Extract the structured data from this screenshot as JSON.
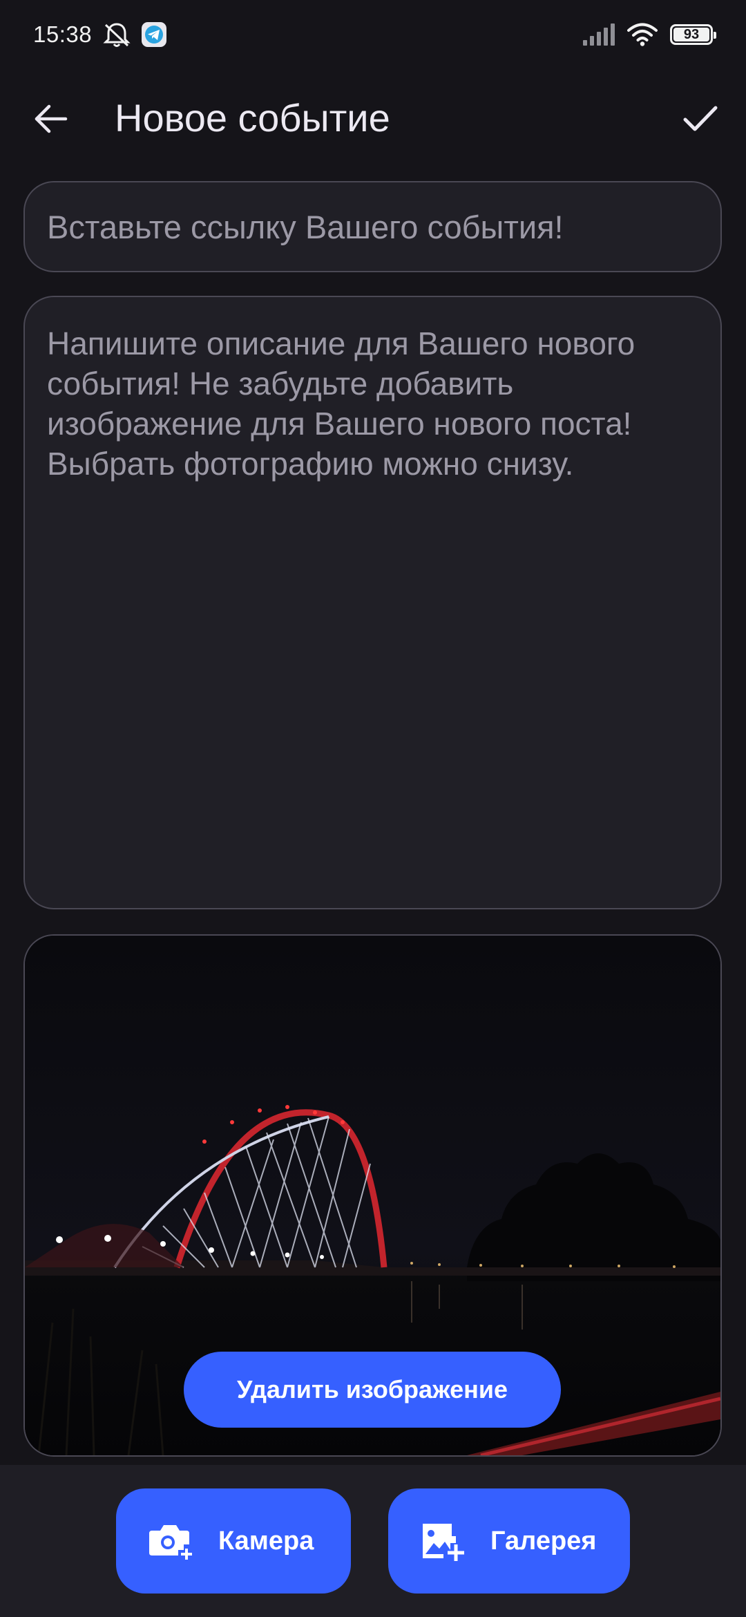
{
  "status_bar": {
    "time": "15:38",
    "battery": "93",
    "icons": [
      "notifications-off-icon",
      "telegram-icon",
      "signal-icon",
      "wifi-icon",
      "battery-icon"
    ]
  },
  "app_bar": {
    "title": "Новое событие",
    "back_icon": "arrow-left-icon",
    "confirm_icon": "checkmark-icon"
  },
  "link_field": {
    "placeholder": "Вставьте ссылку Вашего события!",
    "value": ""
  },
  "description_field": {
    "placeholder": "Напишите описание для Вашего нового события! Не забудьте добавить изображение для Вашего нового поста! Выбрать фотографию можно снизу.",
    "value": ""
  },
  "image_card": {
    "delete_label": "Удалить изображение"
  },
  "bottom_actions": {
    "camera_label": "Камера",
    "gallery_label": "Галерея",
    "camera_icon": "camera-add-icon",
    "gallery_icon": "image-add-icon"
  },
  "colors": {
    "background": "#151419",
    "accent": "#3660ff",
    "field_bg": "#201f26",
    "field_border": "#4a4854",
    "placeholder": "#9c99a6"
  }
}
